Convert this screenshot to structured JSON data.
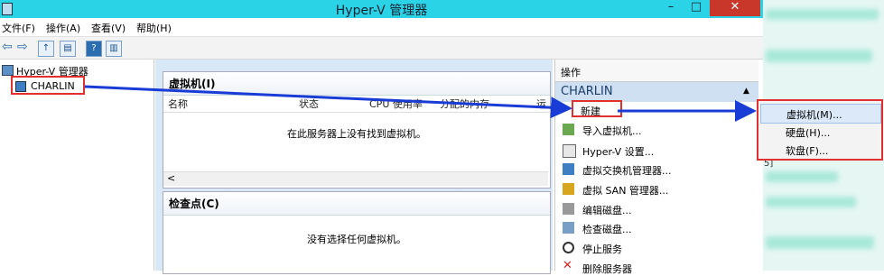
{
  "window": {
    "title": "Hyper-V 管理器",
    "minimize": "–",
    "maximize": "□",
    "close": "✕"
  },
  "menu": [
    "文件(F)",
    "操作(A)",
    "查看(V)",
    "帮助(H)"
  ],
  "tree": {
    "root": "Hyper-V 管理器",
    "server": "CHARLIN"
  },
  "vm_panel": {
    "title": "虚拟机(I)",
    "columns": [
      "名称",
      "状态",
      "CPU 使用率",
      "分配的内存",
      "运"
    ],
    "empty_text": "在此服务器上没有找到虚拟机。",
    "scroll_left": "<"
  },
  "checkpoint_panel": {
    "title": "检查点(C)",
    "empty_text": "没有选择任何虚拟机。"
  },
  "actions": {
    "header": "操作",
    "server": "CHARLIN",
    "collapse": "▲",
    "items": [
      {
        "label": "新建",
        "icon": "new-icon"
      },
      {
        "label": "导入虚拟机...",
        "icon": "import-icon"
      },
      {
        "label": "Hyper-V 设置...",
        "icon": "settings-icon"
      },
      {
        "label": "虚拟交换机管理器...",
        "icon": "switch-icon"
      },
      {
        "label": "虚拟 SAN 管理器...",
        "icon": "san-icon"
      },
      {
        "label": "编辑磁盘...",
        "icon": "edit-disk-icon"
      },
      {
        "label": "检查磁盘...",
        "icon": "inspect-disk-icon"
      },
      {
        "label": "停止服务",
        "icon": "stop-icon"
      },
      {
        "label": "删除服务器",
        "icon": "delete-icon"
      }
    ]
  },
  "submenu": {
    "items": [
      "虚拟机(M)...",
      "硬盘(H)...",
      "软盘(F)..."
    ]
  },
  "side_fragment": "5]",
  "colors": {
    "titlebar": "#2ad4e6",
    "highlight_red": "#e03030",
    "arrow_blue": "#1a3cd6"
  }
}
